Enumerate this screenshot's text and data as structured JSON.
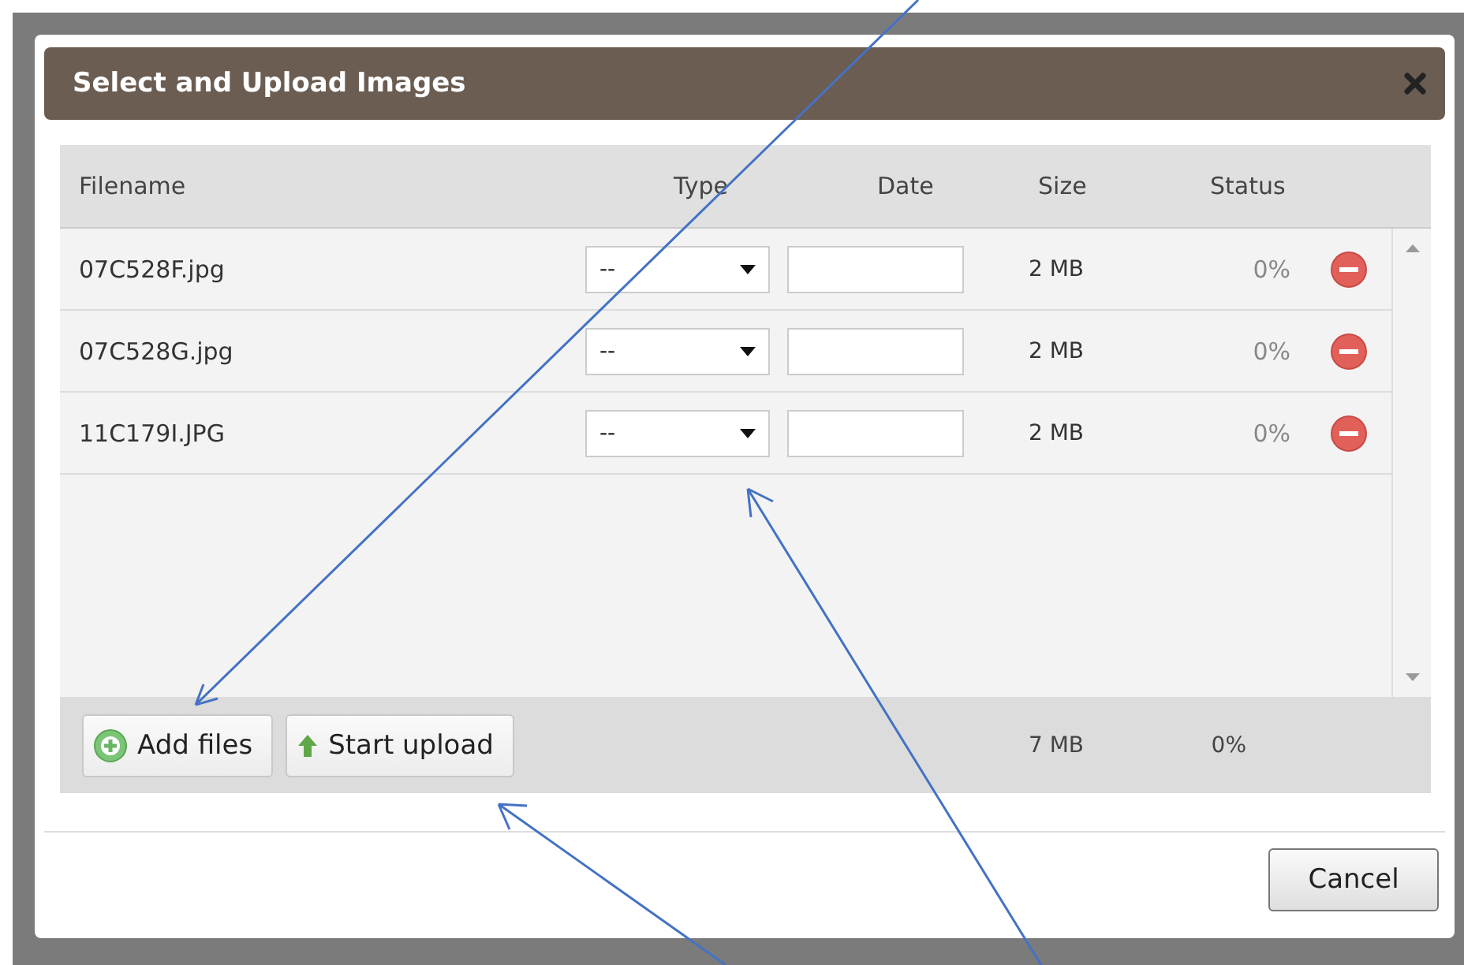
{
  "dialog": {
    "title": "Select and Upload Images"
  },
  "table": {
    "columns": [
      "Filename",
      "Type",
      "Date",
      "Size",
      "Status"
    ],
    "rows": [
      {
        "filename": "07C528F.jpg",
        "type": "--",
        "size": "2 MB",
        "status": "0%"
      },
      {
        "filename": "07C528G.jpg",
        "type": "--",
        "size": "2 MB",
        "status": "0%"
      },
      {
        "filename": "11C179I.JPG",
        "type": "--",
        "size": "2 MB",
        "status": "0%"
      }
    ]
  },
  "footer": {
    "buttons": [
      {
        "label": "Add files",
        "kind": "add"
      },
      {
        "label": "Start upload",
        "kind": "upload"
      }
    ],
    "total_size": "7 MB",
    "total_status": "0%"
  },
  "buttons": [
    "Cancel"
  ]
}
